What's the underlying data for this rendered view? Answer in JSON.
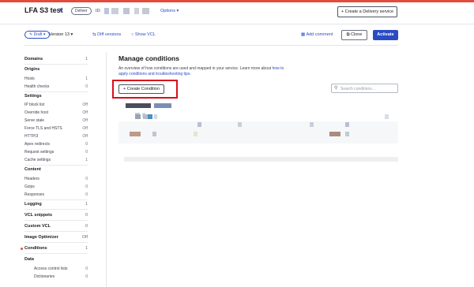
{
  "header": {
    "service_name": "LFA S3 test",
    "service_type": "Deliver",
    "id_label": "ID:",
    "options_label": "Options",
    "create_service_label": "+ Create a Delivery service"
  },
  "toolbar": {
    "status": "Draft",
    "version": "Version 13",
    "diff_label": "Diff versions",
    "show_vcl_label": "Show VCL",
    "add_comment_label": "Add comment",
    "clone_label": "Clone",
    "activate_label": "Activate"
  },
  "sidebar": {
    "domains": {
      "label": "Domains",
      "value": "1"
    },
    "origins": {
      "label": "Origins"
    },
    "hosts": {
      "label": "Hosts",
      "value": "1"
    },
    "health_checks": {
      "label": "Health checks",
      "value": "0"
    },
    "settings": {
      "label": "Settings"
    },
    "ip_block_list": {
      "label": "IP block list",
      "value": "Off"
    },
    "override_host": {
      "label": "Override host",
      "value": "Off"
    },
    "serve_stale": {
      "label": "Serve stale",
      "value": "Off"
    },
    "force_tls": {
      "label": "Force TLS and HSTS",
      "value": "Off"
    },
    "http3": {
      "label": "HTTP/3",
      "value": "Off"
    },
    "apex_redirects": {
      "label": "Apex redirects",
      "value": "0"
    },
    "request_settings": {
      "label": "Request settings",
      "value": "0"
    },
    "cache_settings": {
      "label": "Cache settings",
      "value": "1"
    },
    "content": {
      "label": "Content"
    },
    "headers": {
      "label": "Headers",
      "value": "0"
    },
    "gzips": {
      "label": "Gzips",
      "value": "0"
    },
    "responses": {
      "label": "Responses",
      "value": "0"
    },
    "logging": {
      "label": "Logging",
      "value": "1"
    },
    "vcl_snippets": {
      "label": "VCL snippets",
      "value": "0"
    },
    "custom_vcl": {
      "label": "Custom VCL",
      "value": "0"
    },
    "image_optimizer": {
      "label": "Image Optimizer",
      "value": "Off"
    },
    "conditions": {
      "label": "Conditions",
      "value": "1"
    },
    "data": {
      "label": "Data"
    },
    "access_control_lists": {
      "label": "Access control lists",
      "value": "0"
    },
    "dictionaries": {
      "label": "Dictionaries",
      "value": "0"
    }
  },
  "main": {
    "title": "Manage conditions",
    "description_text": "An overview of how conditions are used and mapped in your service. Learn more about",
    "description_link": "how to apply conditions and troubleshooting tips.",
    "create_condition_label": "+ Create Condition",
    "search_placeholder": "Search conditions..."
  },
  "colors": {
    "accent": "#2a4bc5",
    "brand_red": "#e44b3a",
    "highlight": "#d9101b"
  }
}
